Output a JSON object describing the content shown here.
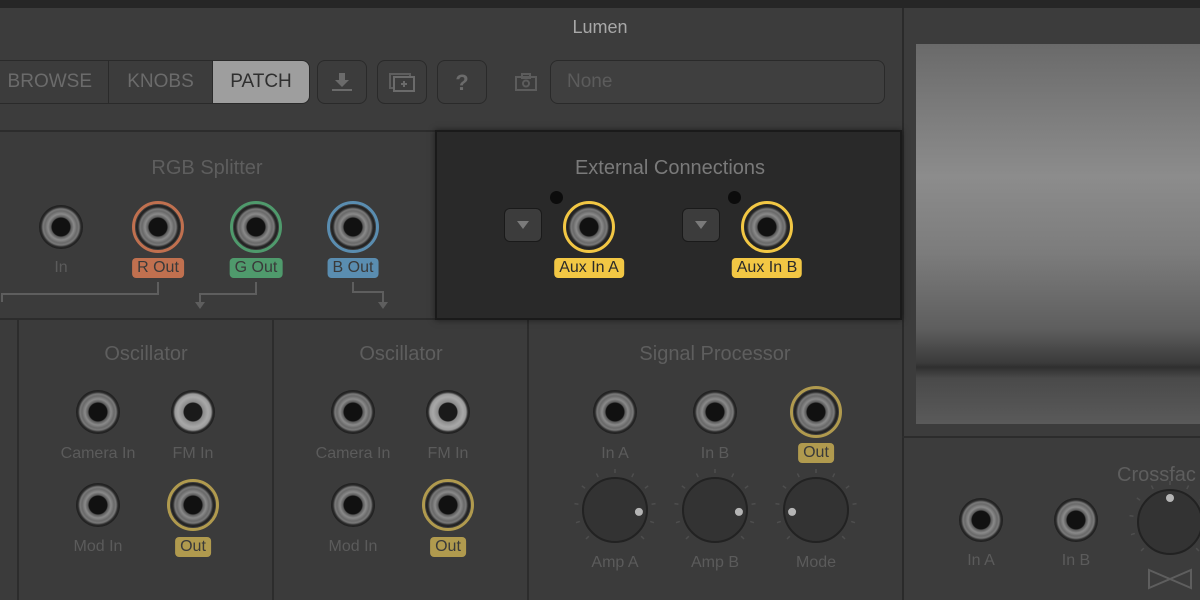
{
  "app": {
    "title": "Lumen"
  },
  "toolbar": {
    "tabs": [
      {
        "label": "BROWSE",
        "active": false
      },
      {
        "label": "KNOBS",
        "active": false
      },
      {
        "label": "PATCH",
        "active": true
      }
    ],
    "buttons": [
      {
        "name": "download-icon"
      },
      {
        "name": "add-layer-icon"
      },
      {
        "name": "help-icon"
      }
    ],
    "camera_icon": "camera-icon",
    "camera_source": {
      "value": "None"
    }
  },
  "modules": {
    "rgb_splitter": {
      "title": "RGB Splitter",
      "jacks": [
        {
          "label": "In",
          "tagged": false
        },
        {
          "label": "R Out",
          "tagged": true,
          "color": "#c0704f"
        },
        {
          "label": "G Out",
          "tagged": true,
          "color": "#4f9a6c"
        },
        {
          "label": "B Out",
          "tagged": true,
          "color": "#5a8db0"
        }
      ]
    },
    "external_connections": {
      "title": "External Connections",
      "jacks": [
        {
          "label": "Aux In A",
          "color": "#f2c744"
        },
        {
          "label": "Aux In B",
          "color": "#f2c744"
        }
      ]
    },
    "oscillator_1": {
      "title": "Oscillator",
      "jacks": [
        {
          "label": "Camera In",
          "tagged": false
        },
        {
          "label": "FM In",
          "tagged": false
        },
        {
          "label": "Mod In",
          "tagged": false
        },
        {
          "label": "Out",
          "tagged": true,
          "color": "#b09a4e"
        }
      ]
    },
    "oscillator_2": {
      "title": "Oscillator",
      "jacks": [
        {
          "label": "Camera In",
          "tagged": false
        },
        {
          "label": "FM In",
          "tagged": false
        },
        {
          "label": "Mod In",
          "tagged": false
        },
        {
          "label": "Out",
          "tagged": true,
          "color": "#b09a4e"
        }
      ]
    },
    "signal_processor": {
      "title": "Signal Processor",
      "jacks": [
        {
          "label": "In A",
          "tagged": false
        },
        {
          "label": "In B",
          "tagged": false
        },
        {
          "label": "Out",
          "tagged": true,
          "color": "#b09a4e"
        }
      ],
      "knobs": [
        {
          "label": "Amp A",
          "value_fraction": 0.85
        },
        {
          "label": "Amp B",
          "value_fraction": 0.85
        },
        {
          "label": "Mode",
          "value_fraction": 0.15
        }
      ]
    },
    "crossfader": {
      "title": "Crossfac",
      "jacks": [
        {
          "label": "In A",
          "tagged": false
        },
        {
          "label": "In B",
          "tagged": false
        }
      ],
      "knobs": [
        {
          "label": "",
          "value_fraction": 0.5
        }
      ],
      "icon": "bowtie-icon"
    }
  },
  "colors": {
    "accent_yellow": "#f2c744",
    "muted_gold": "#b09a4e",
    "red": "#c0704f",
    "green": "#4f9a6c",
    "blue": "#5a8db0"
  }
}
